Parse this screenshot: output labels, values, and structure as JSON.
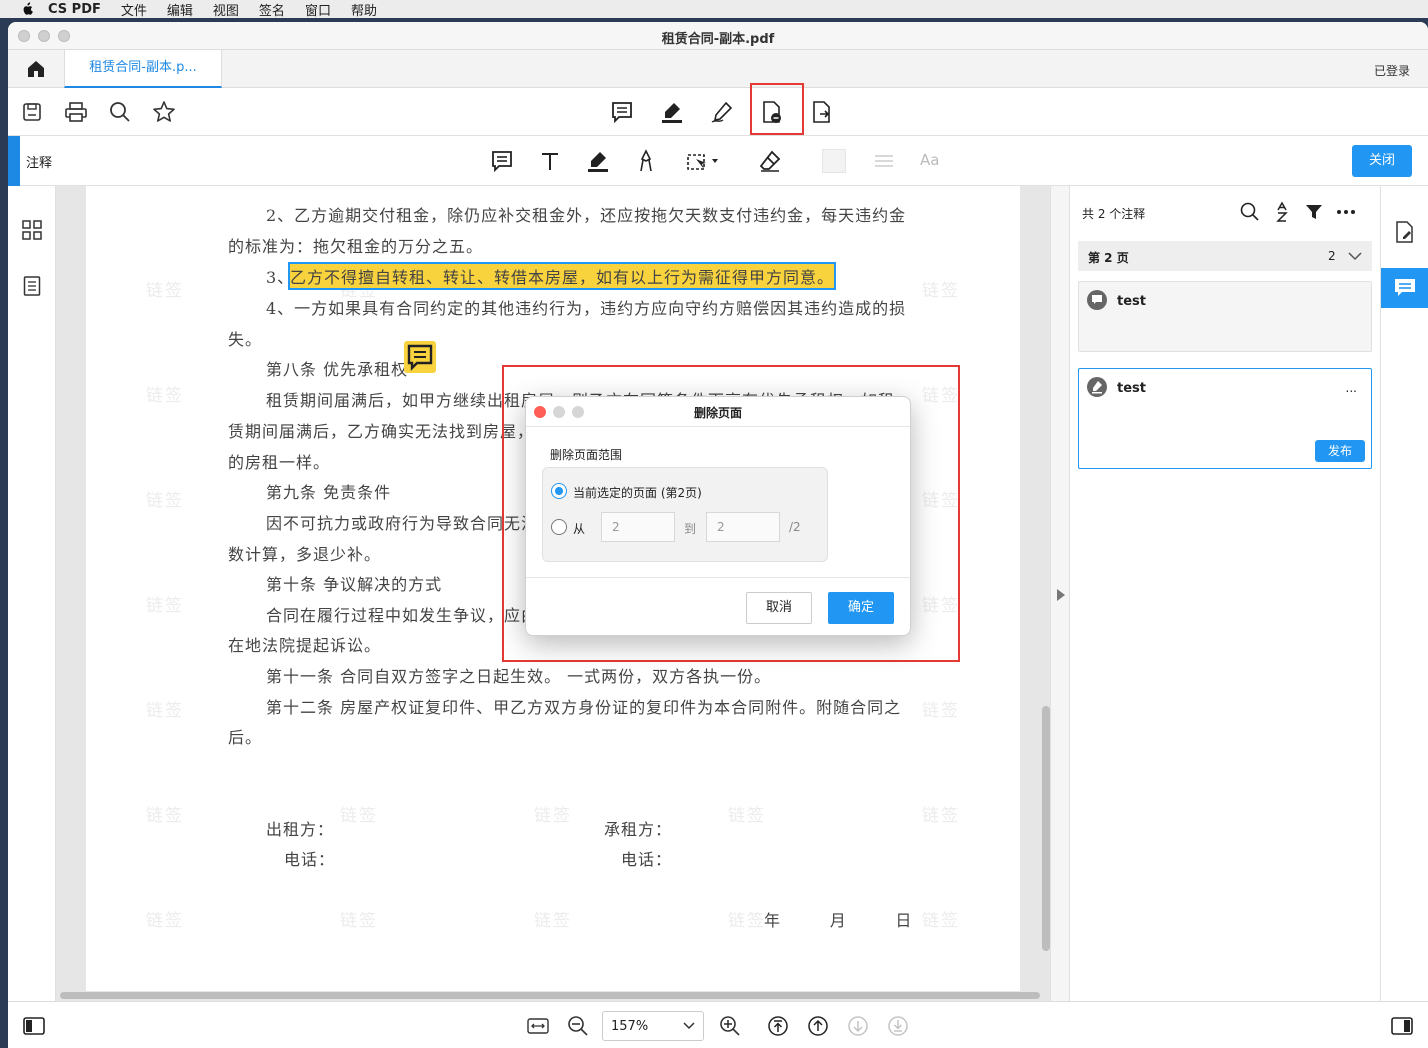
{
  "menubar": {
    "app_name": "CS PDF",
    "items": [
      "文件",
      "编辑",
      "视图",
      "签名",
      "窗口",
      "帮助"
    ]
  },
  "window": {
    "title": "租赁合同-副本.pdf"
  },
  "tabs": {
    "active_tab": "租赁合同-副本.p...",
    "login_status": "已登录"
  },
  "annotation_bar": {
    "label": "注释",
    "font_icon_label": "Aa",
    "close_label": "关闭"
  },
  "document": {
    "lines": [
      "2、乙方逾期交付租金，除仍应补交租金外，还应按拖欠天数支付违约金，每天违约金",
      "的标准为：拖欠租金的万分之五。",
      "3、",
      "乙方不得擅自转租、转让、转借本房屋，如有以上行为需征得甲方同意。",
      "4、一方如果具有合同约定的其他违约行为，违约方应向守约方赔偿因其违约造成的损",
      "失。",
      "第八条  优先承租权",
      "租赁期间届满后，如甲方继续出租房屋，则乙方在同等条件下享有优先承租权。如租",
      "赁期间届满后，乙方确实无法找到房屋，",
      "的房租一样。",
      "第九条  免责条件",
      "因不可抗力或政府行为导致合同无法",
      "数计算，多退少补。",
      "第十条  争议解决的方式",
      "合同在履行过程中如发生争议，应由",
      "在地法院提起诉讼。",
      "第十一条  合同自双方签字之日起生效。  一式两份，双方各执一份。",
      "第十二条  房屋产权证复印件、甲乙方双方身份证的复印件为本合同附件。附随合同之",
      "后。"
    ],
    "signature": {
      "lessor": "出租方：",
      "lessee": "承租方：",
      "phone1": "电话：",
      "phone2": "电话：",
      "date": "年        月        日"
    },
    "watermark": "链签"
  },
  "right_panel": {
    "count_label": "共 2 个注释",
    "page_label": "第 2 页",
    "page_count": "2",
    "comments": [
      {
        "text": "test"
      },
      {
        "text": "test",
        "more": "...",
        "publish": "发布"
      }
    ]
  },
  "dialog": {
    "title": "删除页面",
    "section_label": "删除页面范围",
    "option_current": "当前选定的页面 (第2页)",
    "option_from": "从",
    "from_placeholder": "2",
    "to_label": "到",
    "to_placeholder": "2",
    "total_label": "/2",
    "cancel": "取消",
    "ok": "确定",
    "selected_option": "current"
  },
  "statusbar": {
    "zoom": "157%"
  },
  "colors": {
    "accent": "#2196f3",
    "highlight": "#f9d33d",
    "callout": "#e53935"
  }
}
